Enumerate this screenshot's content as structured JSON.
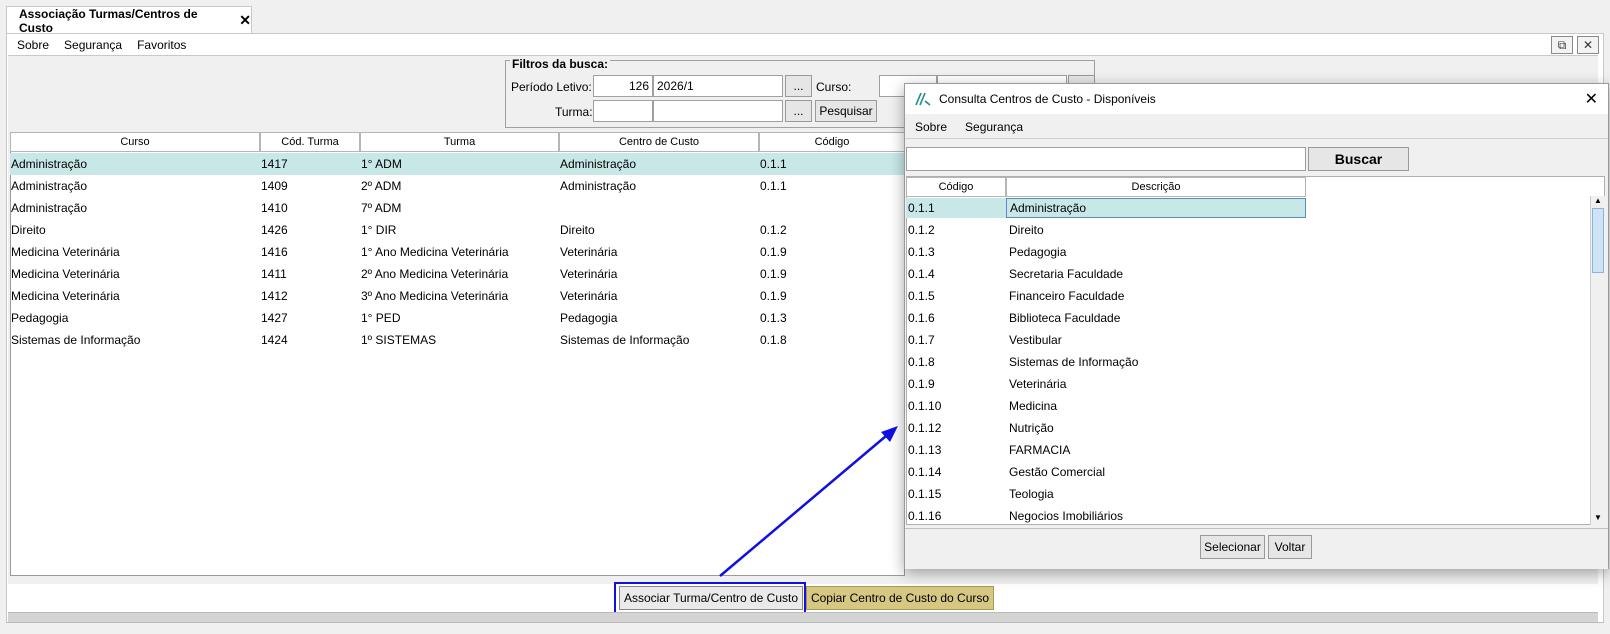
{
  "tab": {
    "title": "Associação Turmas/Centros de Custo",
    "close_glyph": "✕"
  },
  "menu": {
    "items": [
      "Sobre",
      "Segurança",
      "Favoritos"
    ]
  },
  "window_buttons": {
    "popout_icon": "popout-icon",
    "close_icon": "close-icon",
    "popout_glyph": "⧉",
    "close_glyph": "✕"
  },
  "filters": {
    "legend": "Filtros da busca:",
    "periodo_label": "Período Letivo:",
    "periodo_code": "126",
    "periodo_value": "2026/1",
    "curso_label": "Curso:",
    "turma_label": "Turma:",
    "ellipsis": "...",
    "search_button": "Pesquisar"
  },
  "table": {
    "columns": [
      "Curso",
      "Cód. Turma",
      "Turma",
      "Centro de Custo",
      "Código"
    ],
    "rows": [
      [
        "Administração",
        "1417",
        "1° ADM",
        "Administração",
        "0.1.1"
      ],
      [
        "Administração",
        "1409",
        "2º ADM",
        "Administração",
        "0.1.1"
      ],
      [
        "Administração",
        "1410",
        "7º ADM",
        "",
        ""
      ],
      [
        "Direito",
        "1426",
        "1° DIR",
        "Direito",
        "0.1.2"
      ],
      [
        "Medicina Veterinária",
        "1416",
        "1°  Ano Medicina Veterinária",
        "Veterinária",
        "0.1.9"
      ],
      [
        "Medicina Veterinária",
        "1411",
        "2º Ano Medicina Veterinária",
        "Veterinária",
        "0.1.9"
      ],
      [
        "Medicina Veterinária",
        "1412",
        "3º Ano Medicina Veterinária",
        "Veterinária",
        "0.1.9"
      ],
      [
        "Pedagogia",
        "1427",
        "1° PED",
        "Pedagogia",
        "0.1.3"
      ],
      [
        "Sistemas de Informação",
        "1424",
        "1º SISTEMAS",
        "Sistemas de Informação",
        "0.1.8"
      ]
    ]
  },
  "actions": {
    "associate": "Associar Turma/Centro de Custo",
    "copy": "Copiar Centro de Custo do Curso"
  },
  "dialog": {
    "title": "Consulta Centros de Custo - Disponíveis",
    "close_glyph": "✕",
    "menu": [
      "Sobre",
      "Segurança"
    ],
    "search_value": "",
    "search_button": "Buscar",
    "columns": [
      "Código",
      "Descrição"
    ],
    "rows": [
      [
        "0.1.1",
        "Administração"
      ],
      [
        "0.1.2",
        "Direito"
      ],
      [
        "0.1.3",
        "Pedagogia"
      ],
      [
        "0.1.4",
        "Secretaria Faculdade"
      ],
      [
        "0.1.5",
        "Financeiro Faculdade"
      ],
      [
        "0.1.6",
        "Biblioteca Faculdade"
      ],
      [
        "0.1.7",
        "Vestibular"
      ],
      [
        "0.1.8",
        "Sistemas de Informação"
      ],
      [
        "0.1.9",
        "Veterinária"
      ],
      [
        "0.1.10",
        "Medicina"
      ],
      [
        "0.1.12",
        "Nutrição"
      ],
      [
        "0.1.13",
        "FARMACIA"
      ],
      [
        "0.1.14",
        "Gestão Comercial"
      ],
      [
        "0.1.15",
        "Teologia"
      ],
      [
        "0.1.16",
        "Negocios Imobiliários"
      ]
    ],
    "select_button": "Selecionar",
    "back_button": "Voltar"
  },
  "colors": {
    "selection": "#c8e8e8",
    "annotation": "#1010e0",
    "copy_button": "#d6c783"
  }
}
